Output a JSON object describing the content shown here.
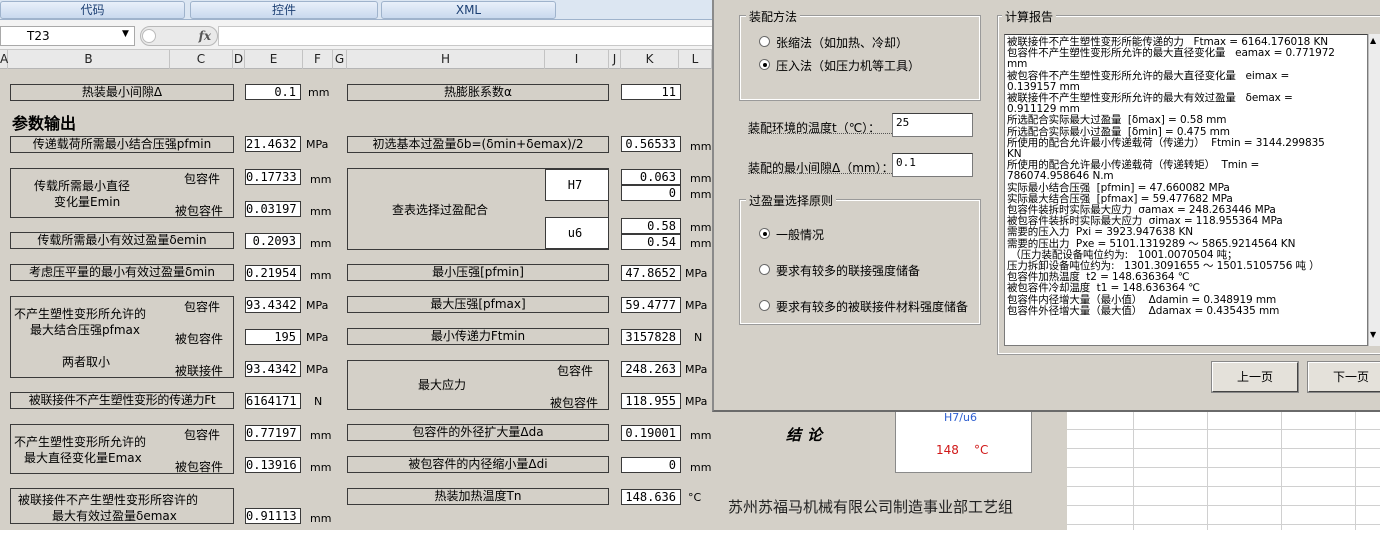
{
  "ribbon": {
    "tabs": [
      "代码",
      "控件",
      "XML"
    ]
  },
  "formula": {
    "name_box": "T23",
    "fx": "fx"
  },
  "columns": [
    "A",
    "B",
    "C",
    "D",
    "E",
    "F",
    "G",
    "H",
    "I",
    "J",
    "K",
    "L"
  ],
  "sheet": {
    "r_min_gap": {
      "label": "热装最小间隙Δ",
      "value": "0.1",
      "unit": "mm"
    },
    "r_expansion": {
      "label": "热膨胀系数α",
      "value": "11"
    },
    "section_title": "参数输出",
    "pfmin_label": "传递载荷所需最小结合压强pfmin",
    "pfmin_value": "21.4632",
    "pfmin_unit": "MPa",
    "delta_b_label": "初选基本过盈量δb=(δmin+δemax)/2",
    "delta_b_value": "0.56533",
    "delta_b_unit": "mm",
    "emin_label1": "传载所需最小直径",
    "emin_label2": "变化量Emin",
    "emin_outer_label": "包容件",
    "emin_outer_value": "0.17733",
    "emin_outer_unit": "mm",
    "emin_inner_label": "被包容件",
    "emin_inner_value": "0.03197",
    "emin_inner_unit": "mm",
    "fit_label": "查表选择过盈配合",
    "fit_hole": "H7",
    "fit_hole_up": "0.063",
    "fit_hole_low": "0",
    "fit_shaft": "u6",
    "fit_shaft_up": "0.58",
    "fit_shaft_low": "0.54",
    "fit_unit": "mm",
    "demin_label": "传载所需最小有效过盈量δemin",
    "demin_value": "0.2093",
    "demin_unit": "mm",
    "dmin_label": "考虑压平量的最小有效过盈量δmin",
    "dmin_value": "0.21954",
    "dmin_unit": "mm",
    "pfmin2_label": "最小压强[pfmin]",
    "pfmin2_value": "47.8652",
    "pfmin2_unit": "MPa",
    "pfmax_label1": "不产生塑性变形所允许的",
    "pfmax_label2": "最大结合压强pfmax",
    "pfmax_label3": "两者取小",
    "pfmax_outer_label": "包容件",
    "pfmax_outer_value": "93.4342",
    "pfmax_outer_unit": "MPa",
    "pfmax_inner_label": "被包容件",
    "pfmax_inner_value": "195",
    "pfmax_inner_unit": "MPa",
    "pfmax_join_label": "被联接件",
    "pfmax_join_value": "93.4342",
    "pfmax_join_unit": "MPa",
    "pfmax2_label": "最大压强[pfmax]",
    "pfmax2_value": "59.4777",
    "pfmax2_unit": "MPa",
    "ftmin_label": "最小传递力Ftmin",
    "ftmin_value": "3157828",
    "ftmin_unit": "N",
    "stress_label": "最大应力",
    "stress_outer_label": "包容件",
    "stress_outer_value": "248.263",
    "stress_outer_unit": "MPa",
    "stress_inner_label": "被包容件",
    "stress_inner_value": "118.955",
    "stress_inner_unit": "MPa",
    "ft_label": "被联接件不产生塑性变形的传递力Ft",
    "ft_value": "6164171",
    "ft_unit": "N",
    "emax_label1": "不产生塑性变形所允许的",
    "emax_label2": "最大直径变化量Emax",
    "emax_outer_label": "包容件",
    "emax_outer_value": "0.77197",
    "emax_outer_unit": "mm",
    "emax_inner_label": "被包容件",
    "emax_inner_value": "0.13916",
    "emax_inner_unit": "mm",
    "da_label": "包容件的外径扩大量Δda",
    "da_value": "0.19001",
    "da_unit": "mm",
    "di_label": "被包容件的内径缩小量Δdi",
    "di_value": "0",
    "di_unit": "mm",
    "demax_label1": "被联接件不产生塑性变形所容许的",
    "demax_label2": "最大有效过盈量δemax",
    "demax_value": "0.91113",
    "demax_unit": "mm",
    "tn_label": "热装加热温度Tn",
    "tn_value": "148.636",
    "tn_unit": "°C",
    "conclusion": "结论",
    "temp_hint": "H7/u6",
    "temp_value": "148",
    "temp_unit": "°C",
    "company": "苏州苏福马机械有限公司制造事业部工艺组"
  },
  "dialog": {
    "method_group": "装配方法",
    "method_options": [
      "张缩法（如加热、冷却）",
      "压入法（如压力机等工具）"
    ],
    "method_selected": 1,
    "env_temp_label": "装配环境的温度t（℃）：",
    "env_temp_value": "25",
    "min_gap_label": "装配的最小间隙Δ（mm）：",
    "min_gap_value": "0.1",
    "principle_group": "过盈量选择原则",
    "principle_options": [
      "一般情况",
      "要求有较多的联接强度储备",
      "要求有较多的被联接件材料强度储备"
    ],
    "principle_selected": 0,
    "report_group": "计算报告",
    "report_lines": [
      "被联接件不产生塑性变形所能传递的力   Ftmax = 6164.176018 KN",
      "包容件不产生塑性变形所允许的最大直径变化量   eamax = 0.771972",
      "mm",
      "被包容件不产生塑性变形所允许的最大直径变化量   eimax =",
      "0.139157 mm",
      "被联接件不产生塑性变形所允许的最大有效过盈量   δemax =",
      "0.911129 mm",
      "所选配合实际最大过盈量  [δmax] = 0.58 mm",
      "所选配合实际最小过盈量  [δmin] = 0.475 mm",
      "所使用的配合允许最小传递载荷（传递力）  Ftmin = 3144.299835",
      "KN",
      "所使用的配合允许最小传递载荷（传递转矩）  Tmin =",
      "786074.958646 N.m",
      "实际最小结合压强  [pfmin] = 47.660082 MPa",
      "实际最大结合压强  [pfmax] = 59.477682 MPa",
      "包容件装拆时实际最大应力  σamax = 248.263446 MPa",
      "被包容件装拆时实际最大应力  σimax = 118.955364 MPa",
      "需要的压入力  Pxi = 3923.947638 KN",
      "需要的压出力  Pxe = 5101.1319289 ～ 5865.9214564 KN",
      " （压力装配设备吨位约为:   1001.0070504 吨；",
      "压力拆卸设备吨位约为:   1301.3091655 ～ 1501.5105756 吨 ）",
      "包容件加热温度  t2 = 148.636364 ℃",
      "被包容件冷却温度  t1 = 148.636364 ℃",
      "包容件内径增大量（最小值）  Δdamin = 0.348919 mm",
      "包容件外径增大量（最大值）  Δdamax = 0.435435 mm"
    ],
    "prev_button": "上一页",
    "next_button": "下一页"
  }
}
